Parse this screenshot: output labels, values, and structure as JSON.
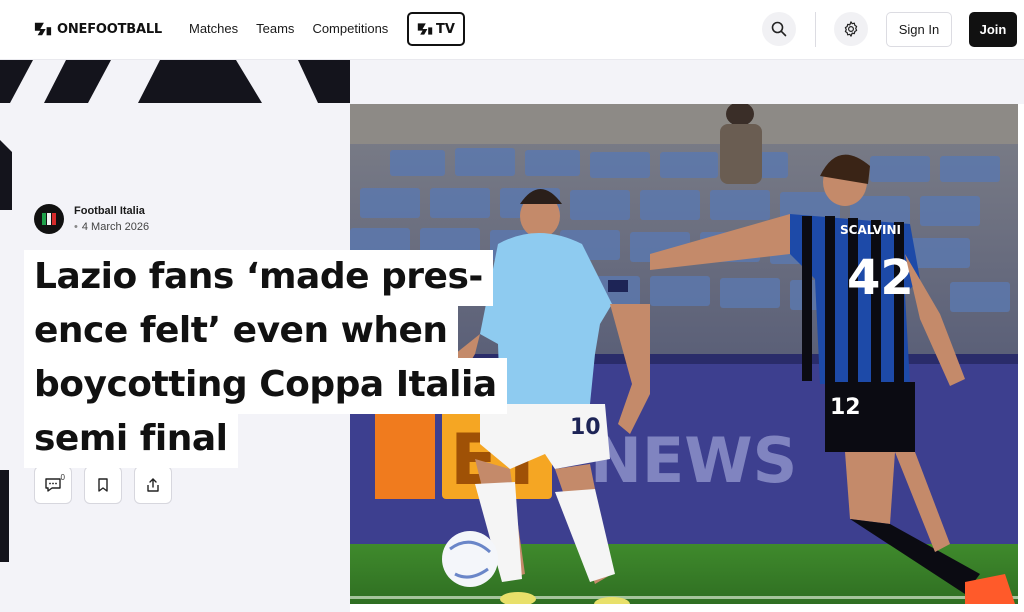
{
  "header": {
    "logo_text": "ONEFOOTBALL",
    "nav": [
      "Matches",
      "Teams",
      "Competitions"
    ],
    "tv_label": "TV",
    "search_icon": "search-icon",
    "settings_icon": "gear-icon",
    "sign_in": "Sign In",
    "join": "Join"
  },
  "article": {
    "publisher": "Football Italia",
    "date": "4 March 2026",
    "headline_lines": [
      "Lazio fans ‘made pres-",
      "ence felt’ even when",
      "boycotting Coppa Italia",
      "semi final"
    ],
    "comment_count": "0",
    "actions": [
      "comment-icon",
      "bookmark-icon",
      "share-icon"
    ],
    "photo_texts": {
      "board_left": "ET",
      "board_right": "NEWS",
      "lazio_number": "10",
      "atalanta_number": "42",
      "atalanta_shorts_number": "12",
      "atalanta_name": "SCALVINI"
    }
  },
  "colors": {
    "brand": "#111111",
    "panel": "#f3f3f8",
    "lazio_blue": "#8ecbf0",
    "atalanta_blue": "#1d4aa8"
  }
}
